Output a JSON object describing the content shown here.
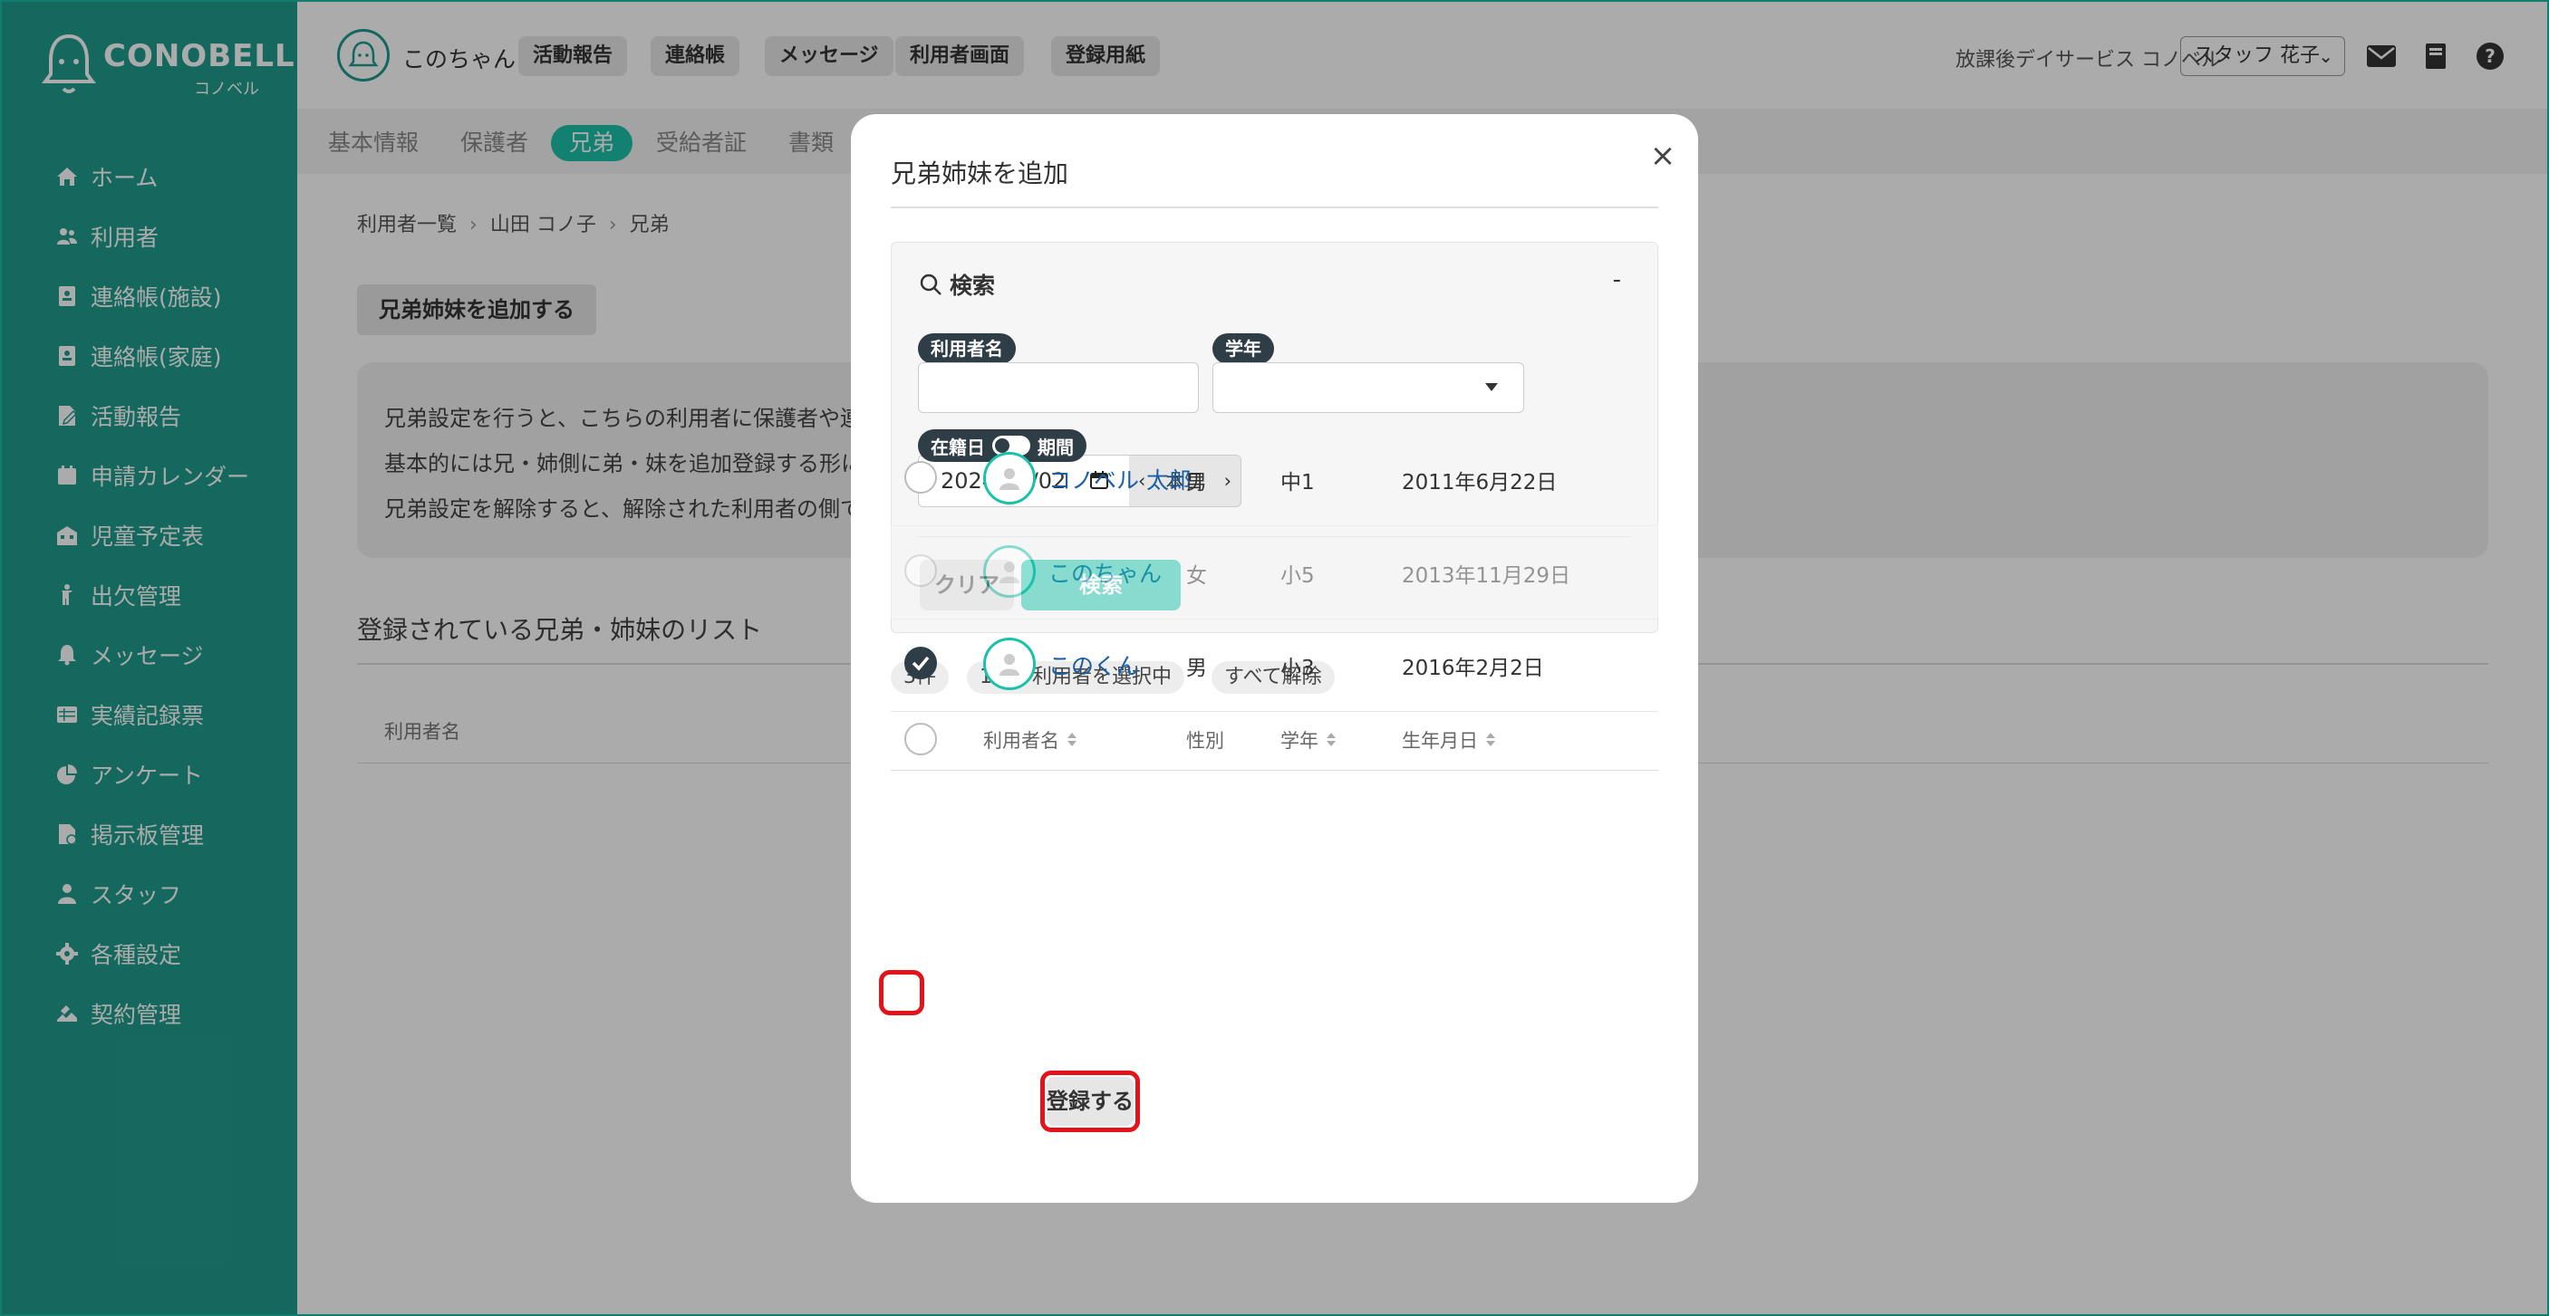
{
  "sidebar": {
    "logo": {
      "brand": "CONOBELL",
      "sub": "コノベル"
    },
    "items": [
      {
        "label": "ホーム",
        "icon": "home-icon"
      },
      {
        "label": "利用者",
        "icon": "users-icon"
      },
      {
        "label": "連絡帳(施設)",
        "icon": "contact-book-icon"
      },
      {
        "label": "連絡帳(家庭)",
        "icon": "contact-book-icon"
      },
      {
        "label": "活動報告",
        "icon": "report-icon"
      },
      {
        "label": "申請カレンダー",
        "icon": "calendar-icon"
      },
      {
        "label": "児童予定表",
        "icon": "building-icon"
      },
      {
        "label": "出欠管理",
        "icon": "child-icon"
      },
      {
        "label": "メッセージ",
        "icon": "bell-icon"
      },
      {
        "label": "実績記録票",
        "icon": "table-icon"
      },
      {
        "label": "アンケート",
        "icon": "pie-chart-icon"
      },
      {
        "label": "掲示板管理",
        "icon": "board-icon"
      },
      {
        "label": "スタッフ",
        "icon": "staff-icon"
      },
      {
        "label": "各種設定",
        "icon": "gear-icon"
      },
      {
        "label": "契約管理",
        "icon": "contract-icon"
      }
    ]
  },
  "header": {
    "user_name": "このちゃん",
    "buttons": [
      "活動報告",
      "連絡帳",
      "メッセージ",
      "利用者画面",
      "登録用紙"
    ],
    "facility": "放課後デイサービス コノベル",
    "staff_selected": "スタッフ 花子"
  },
  "tabs": [
    "基本情報",
    "保護者",
    "兄弟",
    "受給者証",
    "書類"
  ],
  "breadcrumb": [
    "利用者一覧",
    "山田 コノ子",
    "兄弟"
  ],
  "page": {
    "add_sibling_button": "兄弟姉妹を追加する",
    "info_lines": [
      "兄弟設定を行うと、こちらの利用者に保護者や連絡",
      "基本的には兄・姉側に弟・妹を追加登録する形に",
      "兄弟設定を解除すると、解除された利用者の側で"
    ],
    "list_title": "登録されている兄弟・姉妹のリスト",
    "list_column": "利用者名"
  },
  "modal": {
    "title": "兄弟姉妹を追加",
    "search": {
      "heading": "検索",
      "collapse": "-",
      "name_label": "利用者名",
      "name_value": "",
      "grade_label": "学年",
      "grade_value": "",
      "enrolled_label": "在籍日",
      "period_label": "期間",
      "date_value": "2024/09/02",
      "today_label": "本日",
      "clear_button": "クリア",
      "search_button": "検索"
    },
    "result_count": "3件",
    "selected_text": "1人の利用者を選択中",
    "deselect_all": "すべて解除",
    "columns": [
      "利用者名",
      "性別",
      "学年",
      "生年月日"
    ],
    "rows": [
      {
        "name": "コノベル 太郎",
        "gender": "男",
        "grade": "中1",
        "dob": "2011年6月22日",
        "checked": false,
        "disabled": false
      },
      {
        "name": "このちゃん",
        "gender": "女",
        "grade": "小5",
        "dob": "2013年11月29日",
        "checked": false,
        "disabled": true
      },
      {
        "name": "このくん",
        "gender": "男",
        "grade": "小3",
        "dob": "2016年2月2日",
        "checked": true,
        "disabled": false
      }
    ],
    "register_button": "登録する"
  },
  "colors": {
    "accent": "#1bc1a9",
    "sidebar": "#1f9c8d",
    "highlight": "#e3131b",
    "label_dark": "#2f3d46"
  }
}
